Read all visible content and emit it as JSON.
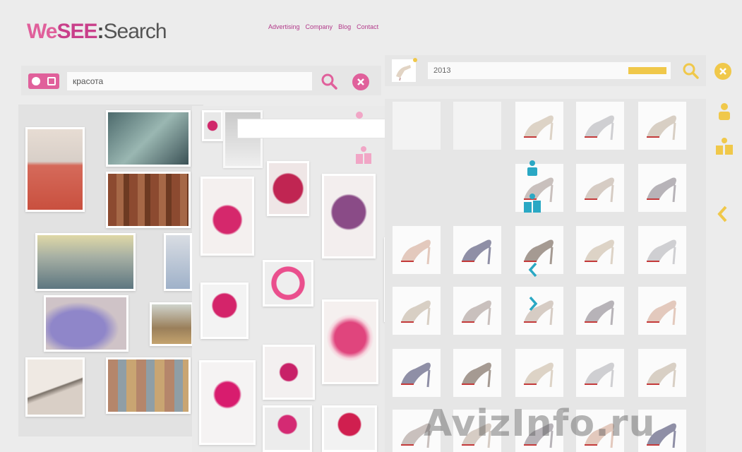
{
  "logo": {
    "we": "We",
    "see": "SEE",
    "colon": ":",
    "search": "Search"
  },
  "topnav": [
    "Advertising",
    "Company",
    "Blog",
    "Contact"
  ],
  "left_search": {
    "value": "красота",
    "search_icon": "magnifier-icon",
    "clear_icon": "close-circle-icon"
  },
  "right_search": {
    "value": "2013",
    "search_icon": "magnifier-icon",
    "clear_icon": "close-circle-icon"
  },
  "colors": {
    "accent_pink": "#e0609b",
    "accent_yellow": "#f0c84a",
    "accent_teal": "#2aa8c4"
  },
  "watermark": "AvizInfo.ru"
}
